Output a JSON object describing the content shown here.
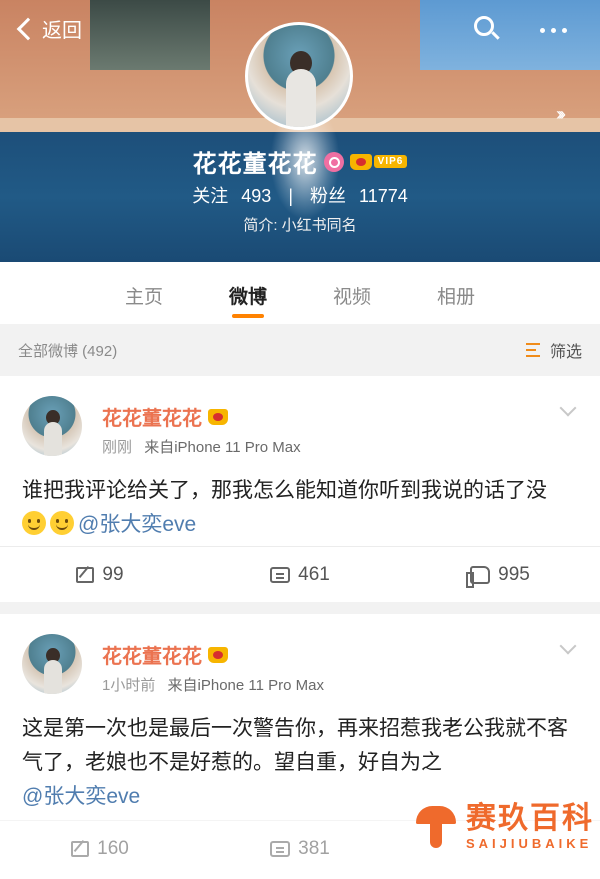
{
  "nav": {
    "back_label": "返回"
  },
  "profile": {
    "name": "花花董花花",
    "vip_label": "VIP6",
    "following_label": "关注",
    "following_count": "493",
    "separator": "|",
    "followers_label": "粉丝",
    "followers_count": "11774",
    "bio": "简介: 小红书同名"
  },
  "tabs": [
    "主页",
    "微博",
    "视频",
    "相册"
  ],
  "active_tab": "微博",
  "filter": {
    "all_label": "全部微博 (492)",
    "filter_label": "筛选"
  },
  "posts": [
    {
      "user": "花花董花花",
      "time": "刚刚",
      "source": "来自iPhone 11 Pro Max",
      "text": "谁把我评论给关了，那我怎么能知道你听到我说的话了没",
      "mention": "@张大奕eve",
      "reposts": "99",
      "comments": "461",
      "likes": "995"
    },
    {
      "user": "花花董花花",
      "time": "1小时前",
      "source": "来自iPhone 11 Pro Max",
      "text": "这是第一次也是最后一次警告你，再来招惹我老公我就不客气了，老娘也不是好惹的。望自重，好自为之",
      "mention": "@张大奕eve",
      "reposts": "160",
      "comments": "381"
    }
  ],
  "watermark": {
    "cn": "赛玖百科",
    "en": "SAIJIUBAIKE"
  },
  "colors": {
    "accent": "#ff8200",
    "username": "#eb7350",
    "mention": "#507daf",
    "vip": "#f7b500"
  }
}
